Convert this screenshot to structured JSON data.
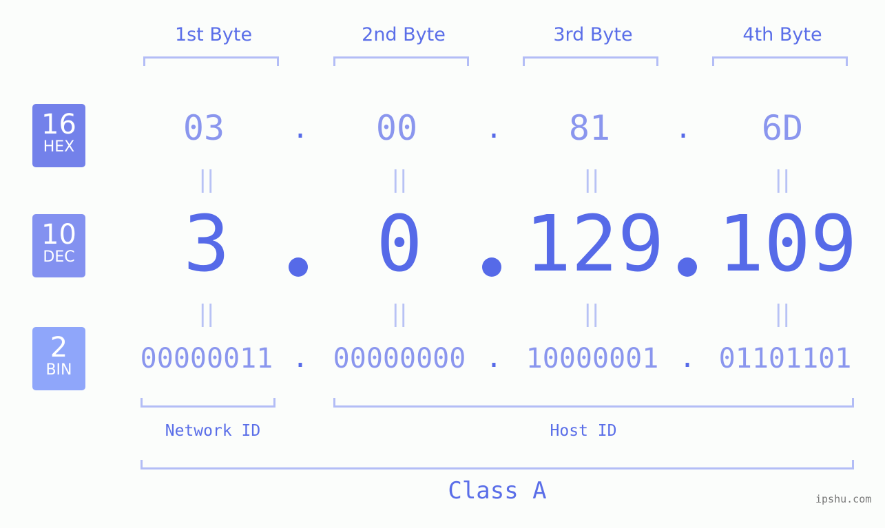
{
  "bytes": [
    {
      "label": "1st Byte",
      "hex": "03",
      "dec": "3",
      "bin": "00000011"
    },
    {
      "label": "2nd Byte",
      "hex": "00",
      "dec": "0",
      "bin": "00000000"
    },
    {
      "label": "3rd Byte",
      "hex": "81",
      "dec": "129",
      "bin": "10000001"
    },
    {
      "label": "4th Byte",
      "hex": "6D",
      "dec": "109",
      "bin": "01101101"
    }
  ],
  "separator": ".",
  "equals_glyph": "||",
  "badges": {
    "hex": {
      "num": "16",
      "label": "HEX",
      "color": "#7381ea"
    },
    "dec": {
      "num": "10",
      "label": "DEC",
      "color": "#8391f0"
    },
    "bin": {
      "num": "2",
      "label": "BIN",
      "color": "#8fa6fa"
    }
  },
  "network_id_label": "Network ID",
  "host_id_label": "Host ID",
  "class_label": "Class A",
  "credit": "ipshu.com",
  "colors": {
    "accent": "#566ae8",
    "light": "#8a96ee",
    "bracket": "#b3bdf6",
    "background": "#fbfdfb"
  }
}
